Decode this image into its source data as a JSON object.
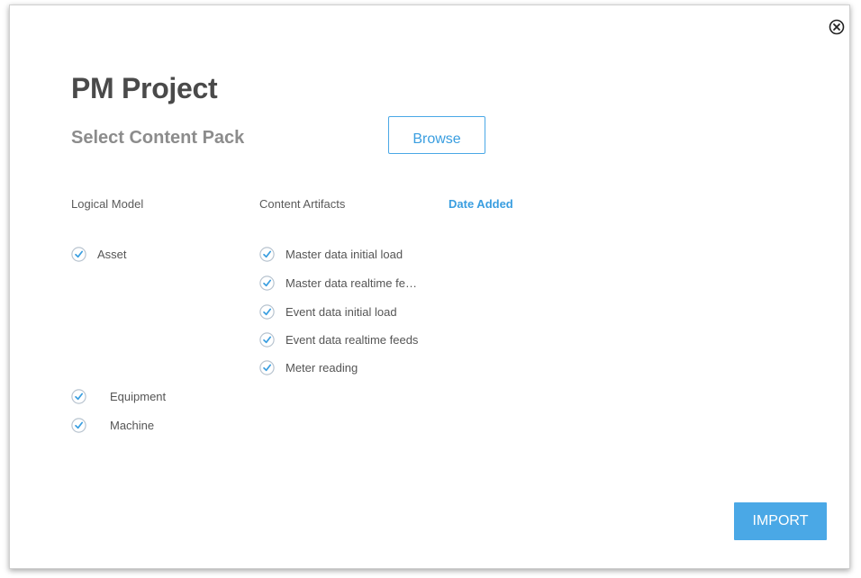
{
  "dialog": {
    "title": "PM Project",
    "subtitle": "Select Content Pack",
    "browse_label": "Browse",
    "import_label": "IMPORT",
    "close_icon": "close-circle-icon"
  },
  "columns": {
    "logical_model": "Logical Model",
    "content_artifacts": "Content Artifacts",
    "date_added": "Date Added"
  },
  "logical_model_items": [
    {
      "label": "Asset",
      "checked": true
    },
    {
      "label": "Equipment",
      "checked": true
    },
    {
      "label": "Machine",
      "checked": true
    }
  ],
  "content_artifacts_items": [
    {
      "label": "Master data initial load",
      "checked": true
    },
    {
      "label": "Master data realtime fe…",
      "checked": true
    },
    {
      "label": "Event data initial load",
      "checked": true
    },
    {
      "label": "Event data realtime feeds",
      "checked": true
    },
    {
      "label": "Meter reading",
      "checked": true
    }
  ],
  "colors": {
    "accent": "#4aa8e6",
    "check_stroke": "#b7c3cf",
    "check_mark": "#3a9ee0"
  }
}
